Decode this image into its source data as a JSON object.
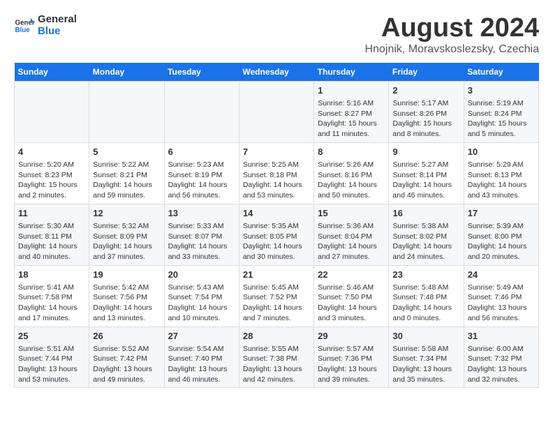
{
  "header": {
    "logo_general": "General",
    "logo_blue": "Blue",
    "title": "August 2024",
    "subtitle": "Hnojnik, Moravskoslezsky, Czechia"
  },
  "days": [
    "Sunday",
    "Monday",
    "Tuesday",
    "Wednesday",
    "Thursday",
    "Friday",
    "Saturday"
  ],
  "weeks": [
    [
      {
        "date": "",
        "sunrise": "",
        "sunset": "",
        "daylight": ""
      },
      {
        "date": "",
        "sunrise": "",
        "sunset": "",
        "daylight": ""
      },
      {
        "date": "",
        "sunrise": "",
        "sunset": "",
        "daylight": ""
      },
      {
        "date": "",
        "sunrise": "",
        "sunset": "",
        "daylight": ""
      },
      {
        "date": "1",
        "sunrise": "5:16 AM",
        "sunset": "8:27 PM",
        "daylight": "15 hours and 11 minutes."
      },
      {
        "date": "2",
        "sunrise": "5:17 AM",
        "sunset": "8:26 PM",
        "daylight": "15 hours and 8 minutes."
      },
      {
        "date": "3",
        "sunrise": "5:19 AM",
        "sunset": "8:24 PM",
        "daylight": "15 hours and 5 minutes."
      }
    ],
    [
      {
        "date": "4",
        "sunrise": "5:20 AM",
        "sunset": "8:23 PM",
        "daylight": "15 hours and 2 minutes."
      },
      {
        "date": "5",
        "sunrise": "5:22 AM",
        "sunset": "8:21 PM",
        "daylight": "14 hours and 59 minutes."
      },
      {
        "date": "6",
        "sunrise": "5:23 AM",
        "sunset": "8:19 PM",
        "daylight": "14 hours and 56 minutes."
      },
      {
        "date": "7",
        "sunrise": "5:25 AM",
        "sunset": "8:18 PM",
        "daylight": "14 hours and 53 minutes."
      },
      {
        "date": "8",
        "sunrise": "5:26 AM",
        "sunset": "8:16 PM",
        "daylight": "14 hours and 50 minutes."
      },
      {
        "date": "9",
        "sunrise": "5:27 AM",
        "sunset": "8:14 PM",
        "daylight": "14 hours and 46 minutes."
      },
      {
        "date": "10",
        "sunrise": "5:29 AM",
        "sunset": "8:13 PM",
        "daylight": "14 hours and 43 minutes."
      }
    ],
    [
      {
        "date": "11",
        "sunrise": "5:30 AM",
        "sunset": "8:11 PM",
        "daylight": "14 hours and 40 minutes."
      },
      {
        "date": "12",
        "sunrise": "5:32 AM",
        "sunset": "8:09 PM",
        "daylight": "14 hours and 37 minutes."
      },
      {
        "date": "13",
        "sunrise": "5:33 AM",
        "sunset": "8:07 PM",
        "daylight": "14 hours and 33 minutes."
      },
      {
        "date": "14",
        "sunrise": "5:35 AM",
        "sunset": "8:05 PM",
        "daylight": "14 hours and 30 minutes."
      },
      {
        "date": "15",
        "sunrise": "5:36 AM",
        "sunset": "8:04 PM",
        "daylight": "14 hours and 27 minutes."
      },
      {
        "date": "16",
        "sunrise": "5:38 AM",
        "sunset": "8:02 PM",
        "daylight": "14 hours and 24 minutes."
      },
      {
        "date": "17",
        "sunrise": "5:39 AM",
        "sunset": "8:00 PM",
        "daylight": "14 hours and 20 minutes."
      }
    ],
    [
      {
        "date": "18",
        "sunrise": "5:41 AM",
        "sunset": "7:58 PM",
        "daylight": "14 hours and 17 minutes."
      },
      {
        "date": "19",
        "sunrise": "5:42 AM",
        "sunset": "7:56 PM",
        "daylight": "14 hours and 13 minutes."
      },
      {
        "date": "20",
        "sunrise": "5:43 AM",
        "sunset": "7:54 PM",
        "daylight": "14 hours and 10 minutes."
      },
      {
        "date": "21",
        "sunrise": "5:45 AM",
        "sunset": "7:52 PM",
        "daylight": "14 hours and 7 minutes."
      },
      {
        "date": "22",
        "sunrise": "5:46 AM",
        "sunset": "7:50 PM",
        "daylight": "14 hours and 3 minutes."
      },
      {
        "date": "23",
        "sunrise": "5:48 AM",
        "sunset": "7:48 PM",
        "daylight": "14 hours and 0 minutes."
      },
      {
        "date": "24",
        "sunrise": "5:49 AM",
        "sunset": "7:46 PM",
        "daylight": "13 hours and 56 minutes."
      }
    ],
    [
      {
        "date": "25",
        "sunrise": "5:51 AM",
        "sunset": "7:44 PM",
        "daylight": "13 hours and 53 minutes."
      },
      {
        "date": "26",
        "sunrise": "5:52 AM",
        "sunset": "7:42 PM",
        "daylight": "13 hours and 49 minutes."
      },
      {
        "date": "27",
        "sunrise": "5:54 AM",
        "sunset": "7:40 PM",
        "daylight": "13 hours and 46 minutes."
      },
      {
        "date": "28",
        "sunrise": "5:55 AM",
        "sunset": "7:38 PM",
        "daylight": "13 hours and 42 minutes."
      },
      {
        "date": "29",
        "sunrise": "5:57 AM",
        "sunset": "7:36 PM",
        "daylight": "13 hours and 39 minutes."
      },
      {
        "date": "30",
        "sunrise": "5:58 AM",
        "sunset": "7:34 PM",
        "daylight": "13 hours and 35 minutes."
      },
      {
        "date": "31",
        "sunrise": "6:00 AM",
        "sunset": "7:32 PM",
        "daylight": "13 hours and 32 minutes."
      }
    ]
  ],
  "labels": {
    "sunrise": "Sunrise:",
    "sunset": "Sunset:",
    "daylight": "Daylight:"
  }
}
